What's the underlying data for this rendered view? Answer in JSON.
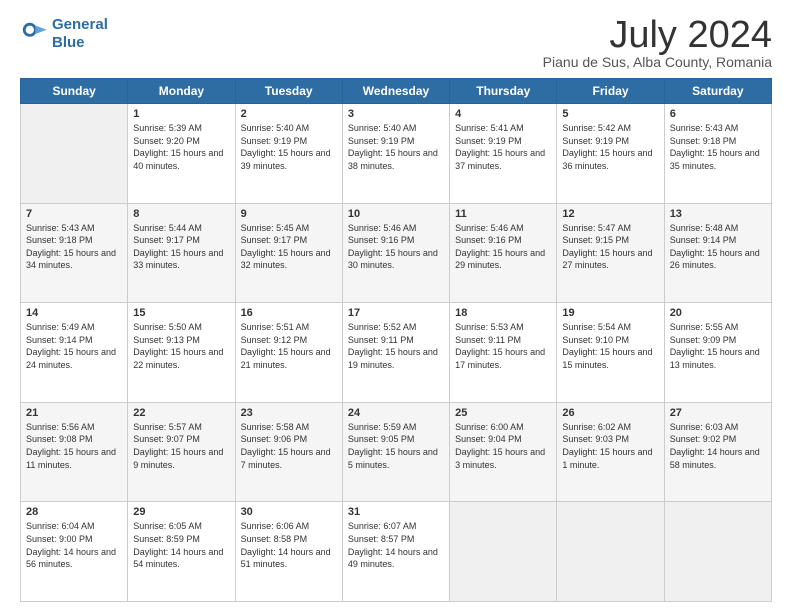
{
  "header": {
    "logo_line1": "General",
    "logo_line2": "Blue",
    "title": "July 2024",
    "subtitle": "Pianu de Sus, Alba County, Romania"
  },
  "days_of_week": [
    "Sunday",
    "Monday",
    "Tuesday",
    "Wednesday",
    "Thursday",
    "Friday",
    "Saturday"
  ],
  "weeks": [
    [
      {
        "day": "",
        "empty": true
      },
      {
        "day": "1",
        "sunrise": "Sunrise: 5:39 AM",
        "sunset": "Sunset: 9:20 PM",
        "daylight": "Daylight: 15 hours and 40 minutes."
      },
      {
        "day": "2",
        "sunrise": "Sunrise: 5:40 AM",
        "sunset": "Sunset: 9:19 PM",
        "daylight": "Daylight: 15 hours and 39 minutes."
      },
      {
        "day": "3",
        "sunrise": "Sunrise: 5:40 AM",
        "sunset": "Sunset: 9:19 PM",
        "daylight": "Daylight: 15 hours and 38 minutes."
      },
      {
        "day": "4",
        "sunrise": "Sunrise: 5:41 AM",
        "sunset": "Sunset: 9:19 PM",
        "daylight": "Daylight: 15 hours and 37 minutes."
      },
      {
        "day": "5",
        "sunrise": "Sunrise: 5:42 AM",
        "sunset": "Sunset: 9:19 PM",
        "daylight": "Daylight: 15 hours and 36 minutes."
      },
      {
        "day": "6",
        "sunrise": "Sunrise: 5:43 AM",
        "sunset": "Sunset: 9:18 PM",
        "daylight": "Daylight: 15 hours and 35 minutes."
      }
    ],
    [
      {
        "day": "7",
        "sunrise": "Sunrise: 5:43 AM",
        "sunset": "Sunset: 9:18 PM",
        "daylight": "Daylight: 15 hours and 34 minutes."
      },
      {
        "day": "8",
        "sunrise": "Sunrise: 5:44 AM",
        "sunset": "Sunset: 9:17 PM",
        "daylight": "Daylight: 15 hours and 33 minutes."
      },
      {
        "day": "9",
        "sunrise": "Sunrise: 5:45 AM",
        "sunset": "Sunset: 9:17 PM",
        "daylight": "Daylight: 15 hours and 32 minutes."
      },
      {
        "day": "10",
        "sunrise": "Sunrise: 5:46 AM",
        "sunset": "Sunset: 9:16 PM",
        "daylight": "Daylight: 15 hours and 30 minutes."
      },
      {
        "day": "11",
        "sunrise": "Sunrise: 5:46 AM",
        "sunset": "Sunset: 9:16 PM",
        "daylight": "Daylight: 15 hours and 29 minutes."
      },
      {
        "day": "12",
        "sunrise": "Sunrise: 5:47 AM",
        "sunset": "Sunset: 9:15 PM",
        "daylight": "Daylight: 15 hours and 27 minutes."
      },
      {
        "day": "13",
        "sunrise": "Sunrise: 5:48 AM",
        "sunset": "Sunset: 9:14 PM",
        "daylight": "Daylight: 15 hours and 26 minutes."
      }
    ],
    [
      {
        "day": "14",
        "sunrise": "Sunrise: 5:49 AM",
        "sunset": "Sunset: 9:14 PM",
        "daylight": "Daylight: 15 hours and 24 minutes."
      },
      {
        "day": "15",
        "sunrise": "Sunrise: 5:50 AM",
        "sunset": "Sunset: 9:13 PM",
        "daylight": "Daylight: 15 hours and 22 minutes."
      },
      {
        "day": "16",
        "sunrise": "Sunrise: 5:51 AM",
        "sunset": "Sunset: 9:12 PM",
        "daylight": "Daylight: 15 hours and 21 minutes."
      },
      {
        "day": "17",
        "sunrise": "Sunrise: 5:52 AM",
        "sunset": "Sunset: 9:11 PM",
        "daylight": "Daylight: 15 hours and 19 minutes."
      },
      {
        "day": "18",
        "sunrise": "Sunrise: 5:53 AM",
        "sunset": "Sunset: 9:11 PM",
        "daylight": "Daylight: 15 hours and 17 minutes."
      },
      {
        "day": "19",
        "sunrise": "Sunrise: 5:54 AM",
        "sunset": "Sunset: 9:10 PM",
        "daylight": "Daylight: 15 hours and 15 minutes."
      },
      {
        "day": "20",
        "sunrise": "Sunrise: 5:55 AM",
        "sunset": "Sunset: 9:09 PM",
        "daylight": "Daylight: 15 hours and 13 minutes."
      }
    ],
    [
      {
        "day": "21",
        "sunrise": "Sunrise: 5:56 AM",
        "sunset": "Sunset: 9:08 PM",
        "daylight": "Daylight: 15 hours and 11 minutes."
      },
      {
        "day": "22",
        "sunrise": "Sunrise: 5:57 AM",
        "sunset": "Sunset: 9:07 PM",
        "daylight": "Daylight: 15 hours and 9 minutes."
      },
      {
        "day": "23",
        "sunrise": "Sunrise: 5:58 AM",
        "sunset": "Sunset: 9:06 PM",
        "daylight": "Daylight: 15 hours and 7 minutes."
      },
      {
        "day": "24",
        "sunrise": "Sunrise: 5:59 AM",
        "sunset": "Sunset: 9:05 PM",
        "daylight": "Daylight: 15 hours and 5 minutes."
      },
      {
        "day": "25",
        "sunrise": "Sunrise: 6:00 AM",
        "sunset": "Sunset: 9:04 PM",
        "daylight": "Daylight: 15 hours and 3 minutes."
      },
      {
        "day": "26",
        "sunrise": "Sunrise: 6:02 AM",
        "sunset": "Sunset: 9:03 PM",
        "daylight": "Daylight: 15 hours and 1 minute."
      },
      {
        "day": "27",
        "sunrise": "Sunrise: 6:03 AM",
        "sunset": "Sunset: 9:02 PM",
        "daylight": "Daylight: 14 hours and 58 minutes."
      }
    ],
    [
      {
        "day": "28",
        "sunrise": "Sunrise: 6:04 AM",
        "sunset": "Sunset: 9:00 PM",
        "daylight": "Daylight: 14 hours and 56 minutes."
      },
      {
        "day": "29",
        "sunrise": "Sunrise: 6:05 AM",
        "sunset": "Sunset: 8:59 PM",
        "daylight": "Daylight: 14 hours and 54 minutes."
      },
      {
        "day": "30",
        "sunrise": "Sunrise: 6:06 AM",
        "sunset": "Sunset: 8:58 PM",
        "daylight": "Daylight: 14 hours and 51 minutes."
      },
      {
        "day": "31",
        "sunrise": "Sunrise: 6:07 AM",
        "sunset": "Sunset: 8:57 PM",
        "daylight": "Daylight: 14 hours and 49 minutes."
      },
      {
        "day": "",
        "empty": true
      },
      {
        "day": "",
        "empty": true
      },
      {
        "day": "",
        "empty": true
      }
    ]
  ]
}
